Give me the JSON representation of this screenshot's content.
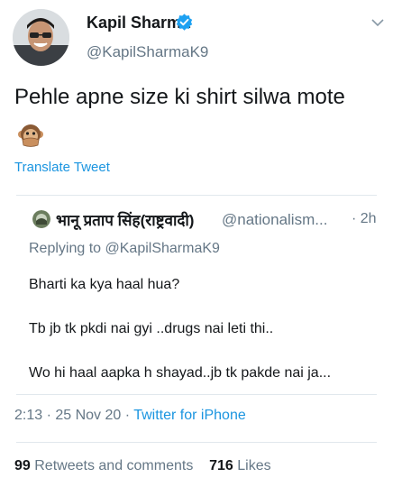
{
  "author": {
    "name": "Kapil Sharma",
    "handle": "@KapilSharmaK9"
  },
  "tweet": {
    "text": "Pehle apne size ki shirt silwa mote",
    "emoji": "🙊",
    "translate_label": "Translate Tweet"
  },
  "quoted": {
    "name": "भानू प्रताप सिंह(राष्ट्रवादी)",
    "handle": "@nationalism...",
    "time": "· 2h",
    "replying_prefix": "Replying to",
    "replying_handle": "@KapilSharmaK9",
    "lines": [
      "Bharti ka kya haal hua?",
      "Tb jb tk pkdi nai gyi ..drugs nai leti thi..",
      "Wo hi haal aapka h shayad..jb tk pakde nai ja..."
    ]
  },
  "meta": {
    "time_date": "2:13 · 25 Nov 20 ·",
    "source": "Twitter for iPhone"
  },
  "stats": {
    "retweets_count": "99",
    "retweets_label": "Retweets and comments",
    "likes_count": "716",
    "likes_label": "Likes"
  },
  "colors": {
    "link": "#1b95e0",
    "secondary": "#657786",
    "divider": "#e1e8ed"
  }
}
